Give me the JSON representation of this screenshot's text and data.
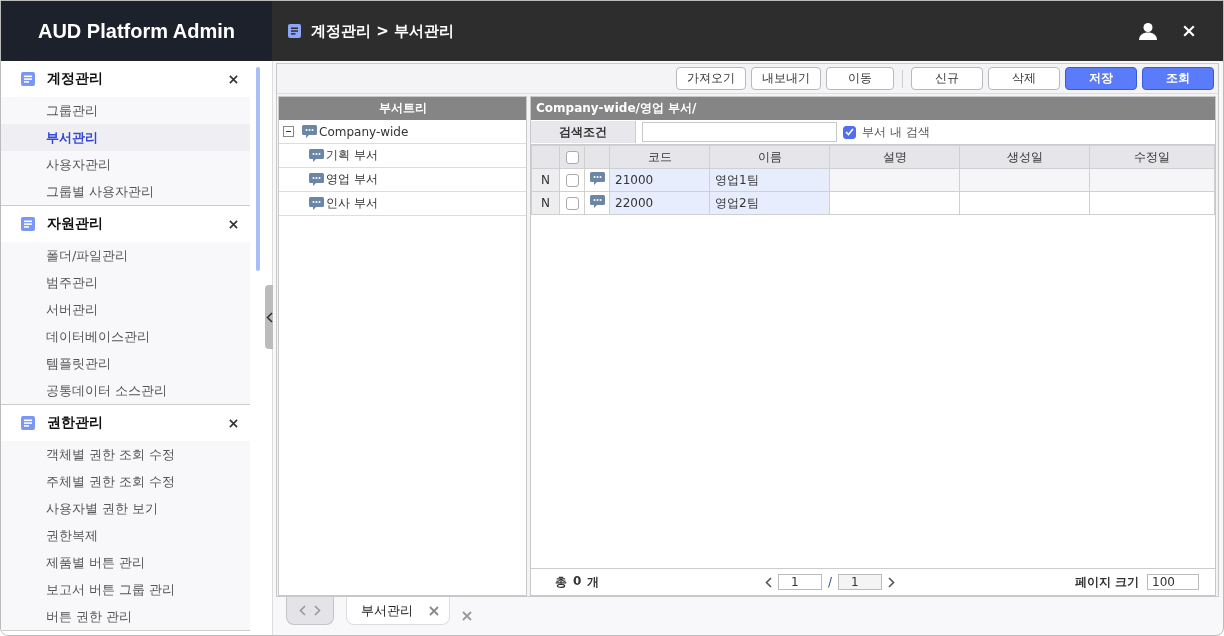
{
  "app_title": "AUD Platform Admin",
  "breadcrumb": "계정관리 > 부서관리",
  "sidebar": {
    "sections": [
      {
        "title": "계정관리",
        "items": [
          {
            "label": "그룹관리",
            "selected": false
          },
          {
            "label": "부서관리",
            "selected": true
          },
          {
            "label": "사용자관리",
            "selected": false
          },
          {
            "label": "그룹별 사용자관리",
            "selected": false
          }
        ]
      },
      {
        "title": "자원관리",
        "items": [
          {
            "label": "폴더/파일관리",
            "selected": false
          },
          {
            "label": "범주관리",
            "selected": false
          },
          {
            "label": "서버관리",
            "selected": false
          },
          {
            "label": "데이터베이스관리",
            "selected": false
          },
          {
            "label": "템플릿관리",
            "selected": false
          },
          {
            "label": "공통데이터 소스관리",
            "selected": false
          }
        ]
      },
      {
        "title": "권한관리",
        "items": [
          {
            "label": "객체별 권한 조회 수정",
            "selected": false
          },
          {
            "label": "주체별 권한 조회 수정",
            "selected": false
          },
          {
            "label": "사용자별 권한 보기",
            "selected": false
          },
          {
            "label": "권한복제",
            "selected": false
          },
          {
            "label": "제품별 버튼 관리",
            "selected": false
          },
          {
            "label": "보고서 버튼 그룹 관리",
            "selected": false
          },
          {
            "label": "버튼 권한 관리",
            "selected": false
          }
        ]
      }
    ]
  },
  "toolbar": {
    "groups": [
      [
        {
          "label": "가져오기",
          "kind": "default"
        },
        {
          "label": "내보내기",
          "kind": "default"
        },
        {
          "label": "이동",
          "kind": "default"
        }
      ],
      [
        {
          "label": "신규",
          "kind": "default"
        },
        {
          "label": "삭제",
          "kind": "default"
        },
        {
          "label": "저장",
          "kind": "primary"
        },
        {
          "label": "조회",
          "kind": "primary"
        }
      ]
    ]
  },
  "tree": {
    "title": "부서트리",
    "nodes": [
      {
        "label": "Company-wide",
        "expanded": true,
        "children": [
          {
            "label": "기획 부서"
          },
          {
            "label": "영업 부서"
          },
          {
            "label": "인사 부서"
          }
        ]
      }
    ]
  },
  "grid": {
    "path": "Company-wide/영업 부서/",
    "search_label": "검색조건",
    "within_dept": {
      "label": "부서 내 검색",
      "checked": true
    },
    "header_checked": false,
    "columns": [
      "코드",
      "이름",
      "설명",
      "생성일",
      "수정일"
    ],
    "rows": [
      {
        "status": "N",
        "checked": false,
        "code": "21000",
        "name": "영업1팀"
      },
      {
        "status": "N",
        "checked": false,
        "code": "22000",
        "name": "영업2팀"
      }
    ],
    "footer": {
      "total_label": "총",
      "total_count": "0",
      "total_unit": "개",
      "page": "1",
      "page_separator": "/",
      "page_count": "1",
      "page_size_label": "페이지 크기",
      "page_size": "100"
    }
  },
  "tabs": [
    {
      "label": "부서관리",
      "selected": true
    }
  ]
}
